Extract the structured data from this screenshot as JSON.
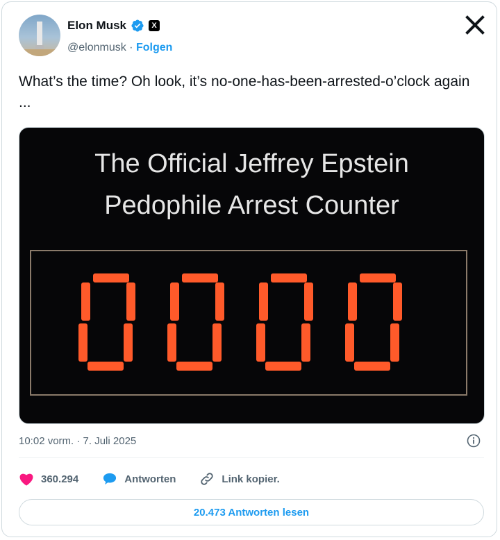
{
  "author": {
    "name": "Elon Musk",
    "handle": "@elonmusk",
    "separator": "·",
    "follow_label": "Folgen",
    "x_badge": "X"
  },
  "tweet": {
    "text": "What’s the time? Oh look, it’s no-one-has-been-arrested-o’clock again ...",
    "timestamp": "10:02 vorm. · 7. Juli 2025"
  },
  "media": {
    "title_line1": "The Official Jeffrey Epstein",
    "title_line2": "Pedophile Arrest Counter",
    "counter_value": "0000",
    "digit_color": "#ff5a2a"
  },
  "actions": {
    "likes": "360.294",
    "reply_label": "Antworten",
    "copy_link_label": "Link kopier."
  },
  "footer": {
    "read_replies_label": "20.473 Antworten lesen"
  },
  "colors": {
    "accent": "#1d9bf0",
    "like": "#f91880",
    "text": "#0f1419",
    "secondary": "#536471"
  },
  "icons": [
    "verified-badge-icon",
    "x-logo-icon",
    "close-icon",
    "info-icon",
    "heart-icon",
    "reply-bubble-icon",
    "link-icon"
  ]
}
